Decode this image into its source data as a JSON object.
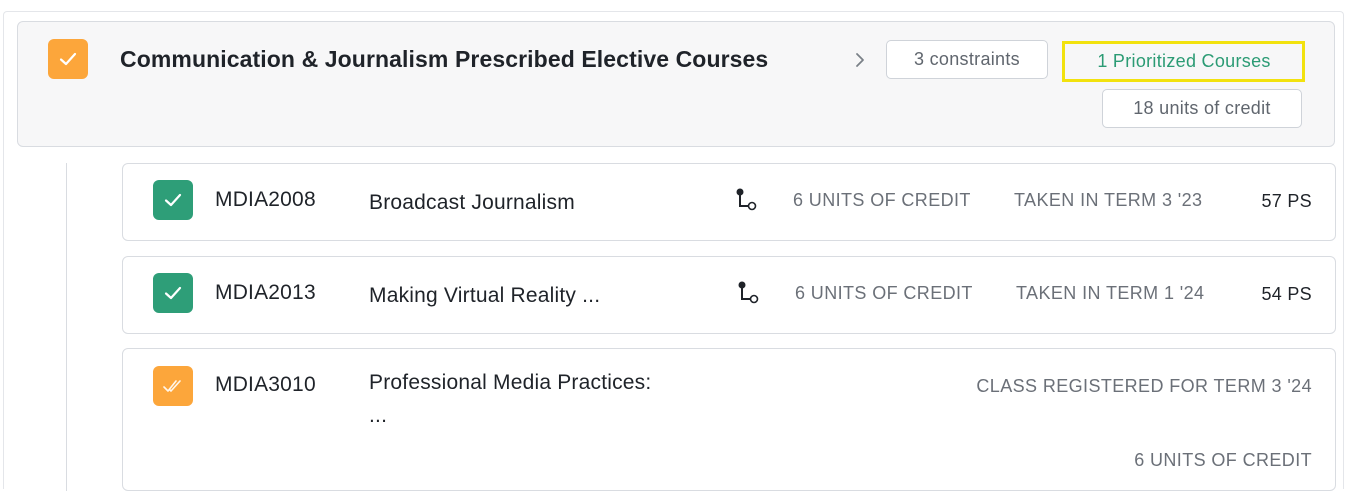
{
  "group": {
    "title": "Communication & Journalism Prescribed Elective Courses",
    "chevron_icon": "chevron-right-icon",
    "constraints_label": "3 constraints",
    "prioritized_label": "1 Prioritized Courses",
    "credit_label": "18 units of credit",
    "check_icon": "check-icon",
    "check_color": "#fca63b"
  },
  "courses": [
    {
      "code": "MDIA2008",
      "name": "Broadcast Journalism",
      "icon": "route-icon",
      "credit": "6 UNITS OF CREDIT",
      "term": "TAKEN IN TERM 3 '23",
      "grade": "57 PS",
      "status_icon": "check-icon",
      "status_color": "#2e9e78"
    },
    {
      "code": "MDIA2013",
      "name": "Making Virtual Reality ...",
      "icon": "route-icon",
      "credit": "6 UNITS OF CREDIT",
      "term": "TAKEN IN TERM 1 '24",
      "grade": "54 PS",
      "status_icon": "check-icon",
      "status_color": "#2e9e78"
    },
    {
      "code": "MDIA3010",
      "name_line1": "Professional Media Practices:",
      "name_line2": "...",
      "status": "CLASS REGISTERED FOR TERM 3 '24",
      "credit": "6 UNITS OF CREDIT",
      "status_icon": "double-check-icon",
      "status_color": "#fca63b"
    }
  ],
  "colors": {
    "highlight": "#f2e20e",
    "green_text": "#2b9b74"
  }
}
